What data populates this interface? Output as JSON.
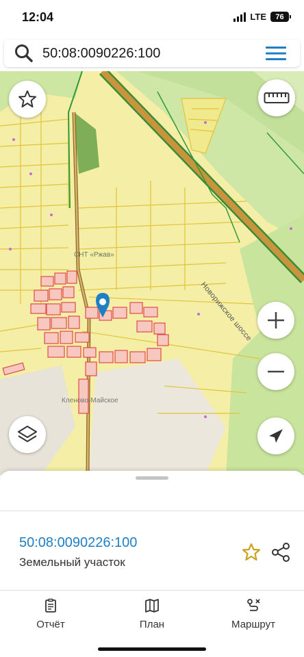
{
  "status_bar": {
    "time": "12:04",
    "network": "LTE",
    "battery": "76"
  },
  "search": {
    "query": "50:08:0090226:100",
    "icon": "search-icon",
    "menu_icon": "hamburger-menu-icon"
  },
  "map": {
    "road_label": "Новорижское шоссе",
    "village_label_top": "СНТ «Ржав»",
    "village_label": "Кленово-Майское",
    "buttons": [
      "favorites-star",
      "ruler",
      "zoom-in",
      "zoom-out",
      "layers",
      "my-location"
    ],
    "colors": {
      "residential_yellow": "#f5eea0",
      "forest_green": "#b9dc8a",
      "dark_green": "#7fae58",
      "parcel_outline": "#e2c33a",
      "building_red": "#e04a4a",
      "road_orange": "#c8953c",
      "pin_blue": "#1e7fc4"
    }
  },
  "sheet": {
    "parcel_number": "50:08:0090226:100",
    "parcel_type": "Земельный участок",
    "favorite_icon": "star-outline-icon",
    "share_icon": "share-icon",
    "accent_color": "#1f7fc4"
  },
  "tabs": [
    {
      "label": "Отчёт",
      "icon": "report-icon"
    },
    {
      "label": "План",
      "icon": "map-plan-icon"
    },
    {
      "label": "Маршрут",
      "icon": "route-icon"
    }
  ]
}
